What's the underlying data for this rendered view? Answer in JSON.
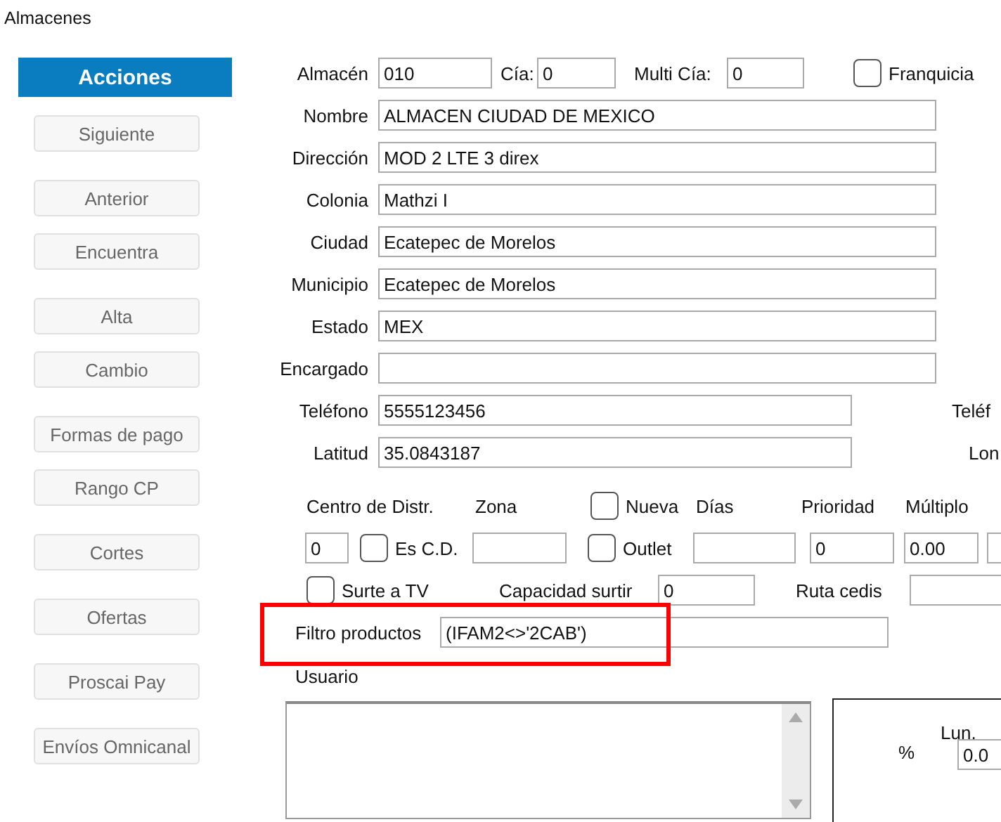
{
  "window": {
    "title": "Almacenes"
  },
  "sidebar": {
    "header": "Acciones",
    "buttons": [
      "Siguiente",
      "Anterior",
      "Encuentra",
      "Alta",
      "Cambio",
      "Formas de pago",
      "Rango CP",
      "Cortes",
      "Ofertas",
      "Proscai Pay",
      "Envíos Omnicanal"
    ]
  },
  "top_row": {
    "almacen": {
      "label": "Almacén",
      "value": "010"
    },
    "cia": {
      "label": "Cía:",
      "value": "0"
    },
    "multi_cia": {
      "label": "Multi Cía:",
      "value": "0"
    },
    "franquicia": {
      "label": "Franquicia",
      "checked": false
    }
  },
  "fields": [
    {
      "label": "Nombre",
      "value": "ALMACEN CIUDAD DE MEXICO",
      "kind": "long"
    },
    {
      "label": "Dirección",
      "value": "MOD 2 LTE 3 direx",
      "kind": "long"
    },
    {
      "label": "Colonia",
      "value": "Mathzi I",
      "kind": "long"
    },
    {
      "label": "Ciudad",
      "value": "Ecatepec de Morelos",
      "kind": "long"
    },
    {
      "label": "Municipio",
      "value": "Ecatepec de Morelos",
      "kind": "long"
    },
    {
      "label": "Estado",
      "value": "MEX",
      "kind": "long"
    },
    {
      "label": "Encargado",
      "kind": "long"
    },
    {
      "label": "Teléfono",
      "value": "5555123456",
      "kind": "short",
      "side_label": "Teléf"
    },
    {
      "label": "Latitud",
      "value": "35.0843187",
      "kind": "short",
      "side_label": "Lon"
    }
  ],
  "distribution": {
    "centro_label": "Centro de Distr.",
    "centro_value": "0",
    "es_cd": {
      "label": "Es C.D.",
      "checked": false
    },
    "zona_label": "Zona",
    "nueva": {
      "label": "Nueva",
      "checked": false
    },
    "outlet": {
      "label": "Outlet",
      "checked": false
    },
    "dias_label": "Días",
    "prioridad_label": "Prioridad",
    "prioridad_value": "0",
    "multiplo_label": "Múltiplo",
    "multiplo_value": "0.00"
  },
  "supply": {
    "surte_tv": {
      "label": "Surte a TV",
      "checked": false
    },
    "capacidad_label": "Capacidad surtir",
    "capacidad_value": "0",
    "ruta_label": "Ruta cedis"
  },
  "filtro": {
    "label": "Filtro productos",
    "value": "(IFAM2<>'2CAB')"
  },
  "usuario": {
    "label": "Usuario"
  },
  "schedule": {
    "day": "Lun.",
    "percent_label": "%",
    "value": "0.0"
  }
}
